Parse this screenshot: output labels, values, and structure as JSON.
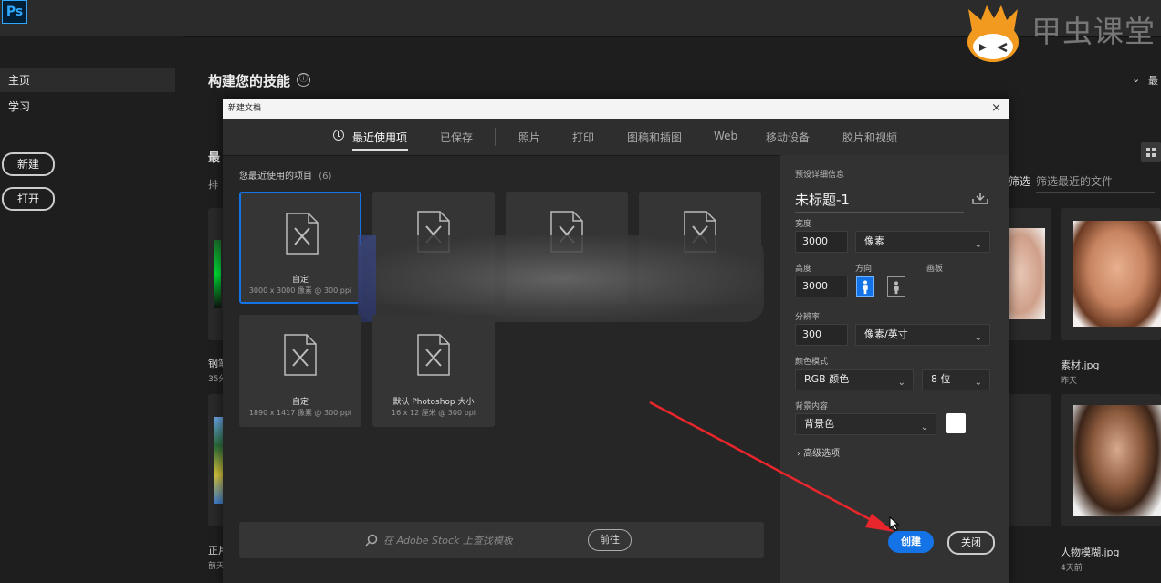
{
  "app": {
    "logo": "Ps"
  },
  "watermark": {
    "text": "甲虫课堂"
  },
  "sidebar": {
    "items": [
      {
        "label": "主页"
      },
      {
        "label": "学习"
      }
    ],
    "new_button": "新建",
    "open_button": "打开"
  },
  "home": {
    "title": "构建您的技能",
    "info_icon": "ⓘ",
    "recent_heading_partial": "最",
    "sort_partial": "排",
    "filter_label": "筛选",
    "filter_placeholder": "筛选最近的文件",
    "top_right_partial": "最",
    "files": [
      {
        "name": "钢笔",
        "time": "35分"
      },
      {
        "name": "素材.jpg",
        "time": "昨天"
      },
      {
        "name": "正片",
        "time": "前天"
      },
      {
        "name": "人物模糊.jpg",
        "time": "4天前"
      }
    ]
  },
  "dialog": {
    "title": "新建文档",
    "close_glyph": "×",
    "tabs": [
      {
        "label": "最近使用项",
        "active": true
      },
      {
        "label": "已保存"
      },
      {
        "label": "照片"
      },
      {
        "label": "打印"
      },
      {
        "label": "图稿和插图"
      },
      {
        "label": "Web"
      },
      {
        "label": "移动设备"
      },
      {
        "label": "胶片和视频"
      }
    ],
    "recent_label": "您最近使用的项目",
    "recent_count": "(6)",
    "presets": [
      {
        "name": "自定",
        "size": "3000 x 3000 像素 @ 300 ppi",
        "selected": true
      },
      {
        "name": "自定",
        "size": "1890 x 1417 像素 @ 300 ppi"
      },
      {
        "name": "默认 Photoshop 大小",
        "size": "16 x 12 厘米 @ 300 ppi"
      }
    ],
    "stock": {
      "placeholder": "在 Adobe Stock 上查找模板",
      "go_button": "前往"
    },
    "details": {
      "heading": "预设详细信息",
      "doc_name": "未标题-1",
      "width_label": "宽度",
      "width_value": "3000",
      "width_unit": "像素",
      "height_label": "高度",
      "height_value": "3000",
      "orientation_label": "方向",
      "artboard_label": "画板",
      "resolution_label": "分辨率",
      "resolution_value": "300",
      "resolution_unit": "像素/英寸",
      "color_mode_label": "颜色模式",
      "color_mode": "RGB 颜色",
      "bit_depth": "8 位",
      "background_label": "背景内容",
      "background_value": "背景色",
      "background_color": "#ffffff",
      "advanced": "高级选项",
      "create_button": "创建",
      "close_button": "关闭"
    }
  },
  "colors": {
    "accent": "#1473e6",
    "annotation_arrow": "#e8262b"
  }
}
